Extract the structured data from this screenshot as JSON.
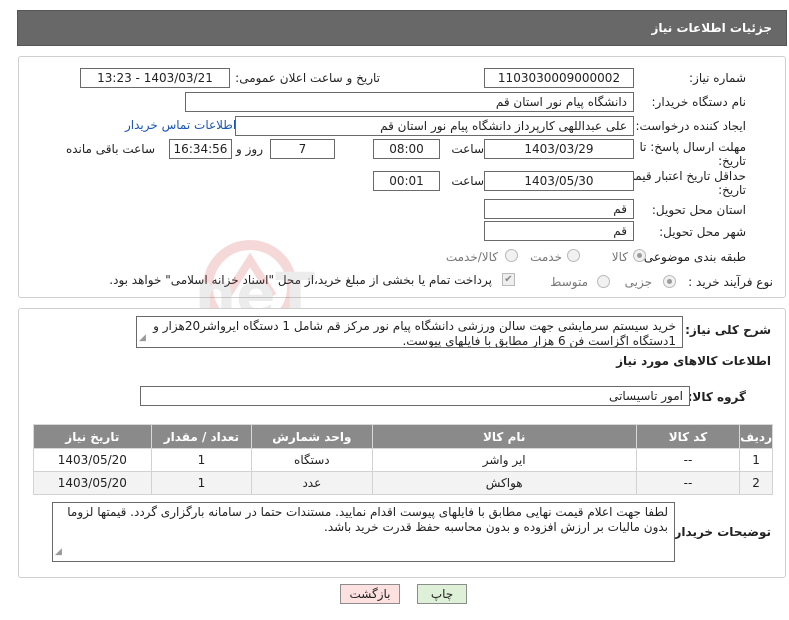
{
  "header": {
    "title": "جزئیات اطلاعات نیاز"
  },
  "need": {
    "number_label": "شماره نیاز:",
    "number": "1103030009000002",
    "announce_label": "تاریخ و ساعت اعلان عمومی:",
    "announce_value": "1403/03/21 - 13:23",
    "buyer_label": "نام دستگاه خریدار:",
    "buyer": "دانشگاه پیام نور استان قم",
    "creator_label": "ایجاد کننده درخواست:",
    "creator": "علی عبداللهی کارپرداز دانشگاه پیام نور استان قم",
    "buyer_contact_link": "اطلاعات تماس خریدار",
    "deadline_label_1": "مهلت ارسال پاسخ: تا",
    "deadline_label_2": "تاریخ:",
    "deadline_date": "1403/03/29",
    "time_label": "ساعت",
    "deadline_time": "08:00",
    "days_value": "7",
    "days_label": "روز و",
    "remaining_value": "16:34:56",
    "remaining_label": "ساعت باقی مانده",
    "validity_label_1": "حداقل تاریخ اعتبار قیمت: تا",
    "validity_label_2": "تاریخ:",
    "validity_date": "1403/05/30",
    "validity_time": "00:01",
    "province_label": "استان محل تحویل:",
    "province": "قم",
    "city_label": "شهر محل تحویل:",
    "city": "قم",
    "category_label": "طبقه بندی موضوعی:",
    "category_options": [
      "کالا",
      "خدمت",
      "کالا/خدمت"
    ],
    "process_label": "نوع فرآیند خرید :",
    "process_options": [
      "جزیی",
      "متوسط"
    ],
    "payment_note": "پرداخت تمام یا بخشی از مبلغ خرید،از محل \"اسناد خزانه اسلامی\" خواهد بود."
  },
  "details": {
    "description_label": "شرح کلی نیاز:",
    "description": "خرید سیستم سرمایشی جهت سالن ورزشی دانشگاه پیام نور مرکز قم شامل 1 دستگاه ایرواشر20هزار و 1دستگاه اگزاست فن 6 هزار مطابق با فایلهای پیوست.",
    "goods_info_title": "اطلاعات کالاهای مورد نیاز",
    "goods_group_label": "گروه کالا:",
    "goods_group": "امور تاسیساتی",
    "table_headers": [
      "ردیف",
      "کد کالا",
      "نام کالا",
      "واحد شمارش",
      "تعداد / مقدار",
      "تاریخ نیاز"
    ],
    "rows": [
      [
        "1",
        "--",
        "ایر واشر",
        "دستگاه",
        "1",
        "1403/05/20"
      ],
      [
        "2",
        "--",
        "هواکش",
        "عدد",
        "1",
        "1403/05/20"
      ]
    ],
    "buyer_notes_label": "توضیحات خریدار:",
    "buyer_notes": "لطفا جهت اعلام قیمت نهایی مطابق با فایلهای پیوست اقدام نمایید. مستندات حتما در سامانه بارگزاری گردد. قیمتها لزوما بدون مالیات بر ارزش افزوده و بدون محاسبه حفظ قدرت خرید باشد."
  },
  "buttons": {
    "print": "چاپ",
    "back": "بازگشت"
  },
  "colors": {
    "header_bg": "#686868",
    "table_header_bg": "#8a8a8a",
    "back_button_bg": "#fde0e0",
    "print_button_bg": "#dff0d8"
  }
}
